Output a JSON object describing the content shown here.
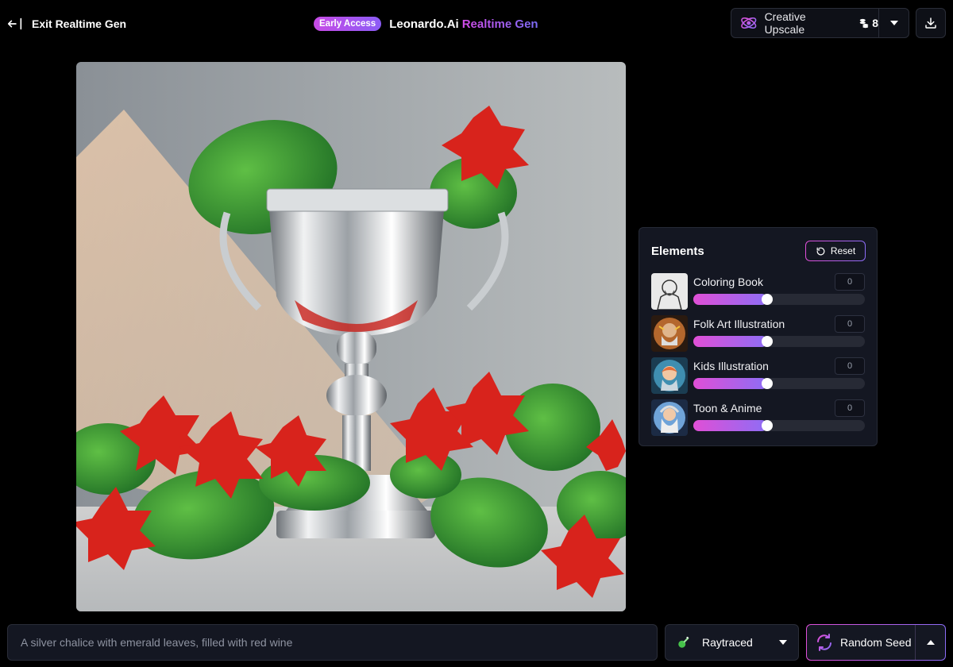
{
  "header": {
    "exit_label": "Exit Realtime Gen",
    "badge": "Early Access",
    "brand": "Leonardo.Ai",
    "mode": "Realtime Gen",
    "upscale_label": "Creative Upscale",
    "upscale_cost": "8"
  },
  "canvas": {
    "subject": "silver chalice with leaves and red flowers"
  },
  "elements_panel": {
    "title": "Elements",
    "reset_label": "Reset",
    "items": [
      {
        "name": "Coloring Book",
        "value": "0",
        "slider_fraction": 0.4
      },
      {
        "name": "Folk Art Illustration",
        "value": "0",
        "slider_fraction": 0.4
      },
      {
        "name": "Kids Illustration",
        "value": "0",
        "slider_fraction": 0.4
      },
      {
        "name": "Toon & Anime",
        "value": "0",
        "slider_fraction": 0.4
      }
    ]
  },
  "bottom": {
    "prompt_placeholder": "A silver chalice with emerald leaves, filled with red wine",
    "style_label": "Raytraced",
    "seed_label": "Random Seed"
  },
  "colors": {
    "accent_pink": "#e14fd9",
    "accent_purple": "#8b6cf6",
    "panel_bg": "#141722"
  }
}
